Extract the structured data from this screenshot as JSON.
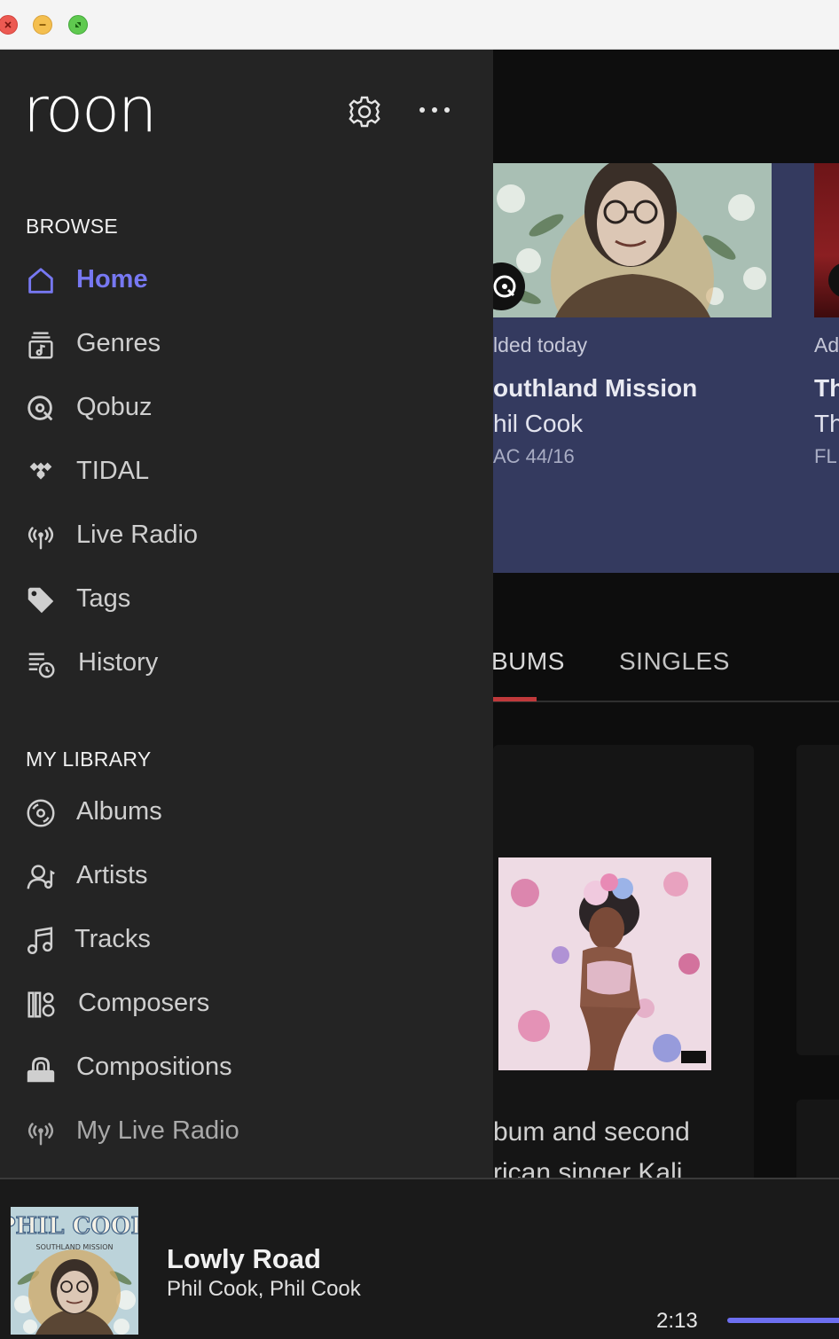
{
  "app": "Roon",
  "colors": {
    "accent": "#7778f2",
    "sidebar_bg": "#242424",
    "card_bg": "#343a5f",
    "tab_underline": "#c0393b"
  },
  "toolbar": {
    "settings_icon": "gear-icon",
    "more_icon": "more-dots-icon"
  },
  "sidebar": {
    "logo_text": "roon",
    "browse_heading": "BROWSE",
    "browse_items": [
      {
        "label": "Home",
        "icon": "home-icon",
        "active": true
      },
      {
        "label": "Genres",
        "icon": "genres-icon"
      },
      {
        "label": "Qobuz",
        "icon": "qobuz-icon"
      },
      {
        "label": "TIDAL",
        "icon": "tidal-icon"
      },
      {
        "label": "Live Radio",
        "icon": "radio-icon"
      },
      {
        "label": "Tags",
        "icon": "tag-icon"
      },
      {
        "label": "History",
        "icon": "history-icon"
      }
    ],
    "library_heading": "MY LIBRARY",
    "library_items": [
      {
        "label": "Albums",
        "icon": "album-icon"
      },
      {
        "label": "Artists",
        "icon": "artist-icon"
      },
      {
        "label": "Tracks",
        "icon": "music-note-icon"
      },
      {
        "label": "Composers",
        "icon": "composers-icon"
      },
      {
        "label": "Compositions",
        "icon": "compositions-icon"
      },
      {
        "label": "My Live Radio",
        "icon": "radio-icon"
      }
    ]
  },
  "main": {
    "card1": {
      "subtitle": "lded today",
      "title": "outhland Mission",
      "artist": "hil Cook",
      "format": "AC 44/16"
    },
    "card2": {
      "subtitle": "Ad",
      "title": "Th",
      "artist": "Th",
      "format": "FL"
    },
    "tabs": [
      {
        "label": "BUMS",
        "active": true
      },
      {
        "label": "SINGLES",
        "active": false
      }
    ],
    "description_lines": [
      "bum and second",
      "rican singer Kali"
    ]
  },
  "now_playing": {
    "title": "Lowly Road",
    "artist": "Phil Cook, Phil Cook",
    "elapsed": "2:13",
    "art_text": "PHIL COOK",
    "art_subtext": "SOUTHLAND MISSION"
  }
}
